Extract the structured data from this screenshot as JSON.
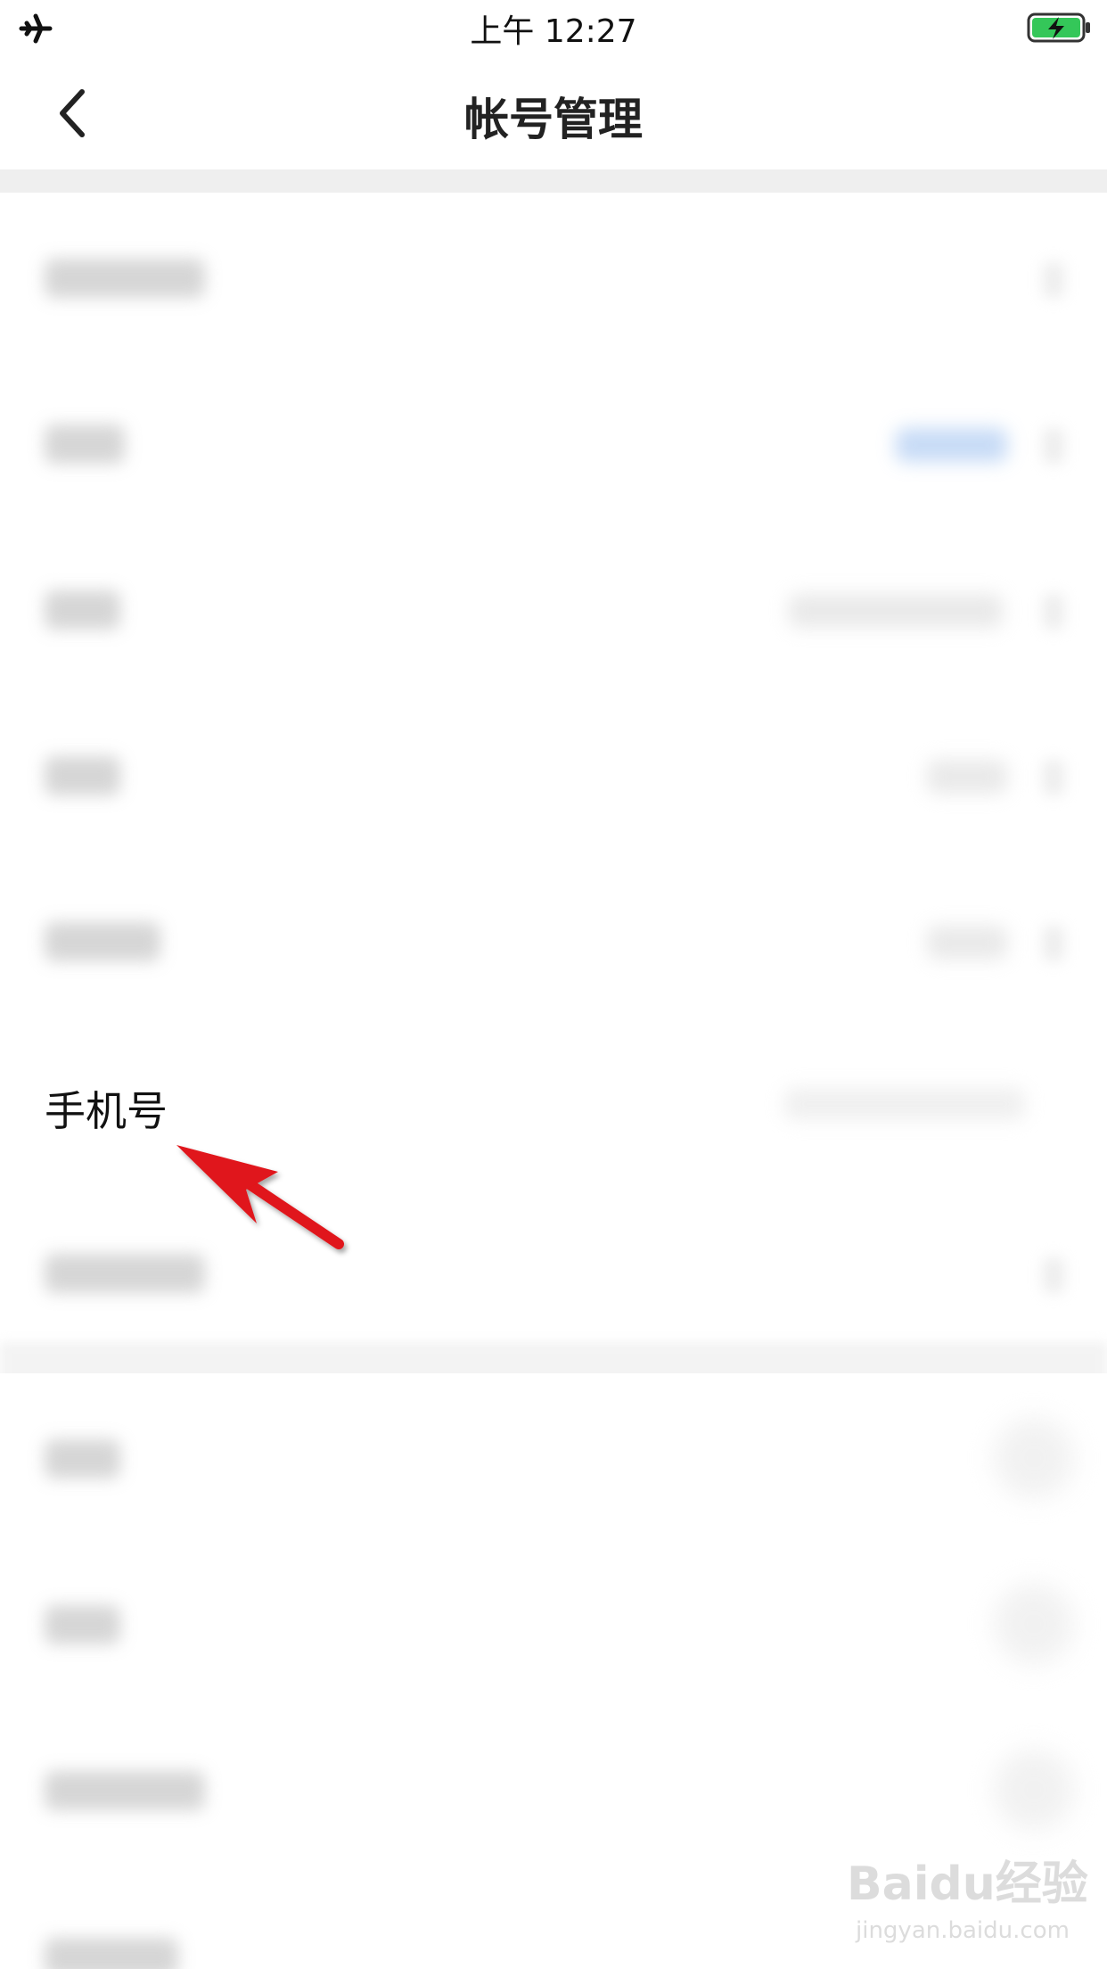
{
  "status_bar": {
    "time": "上午 12:27",
    "airplane_icon": "airplane-icon",
    "battery_icon": "battery-charging-icon",
    "battery_color": "#34c759"
  },
  "nav": {
    "title": "帐号管理",
    "back_icon": "chevron-left-icon"
  },
  "rows": [
    {
      "label": "手机号"
    }
  ],
  "annotation": {
    "arrow_color": "#e0151a"
  },
  "watermark": {
    "logo": "Baidu经验",
    "url": "jingyan.baidu.com"
  }
}
